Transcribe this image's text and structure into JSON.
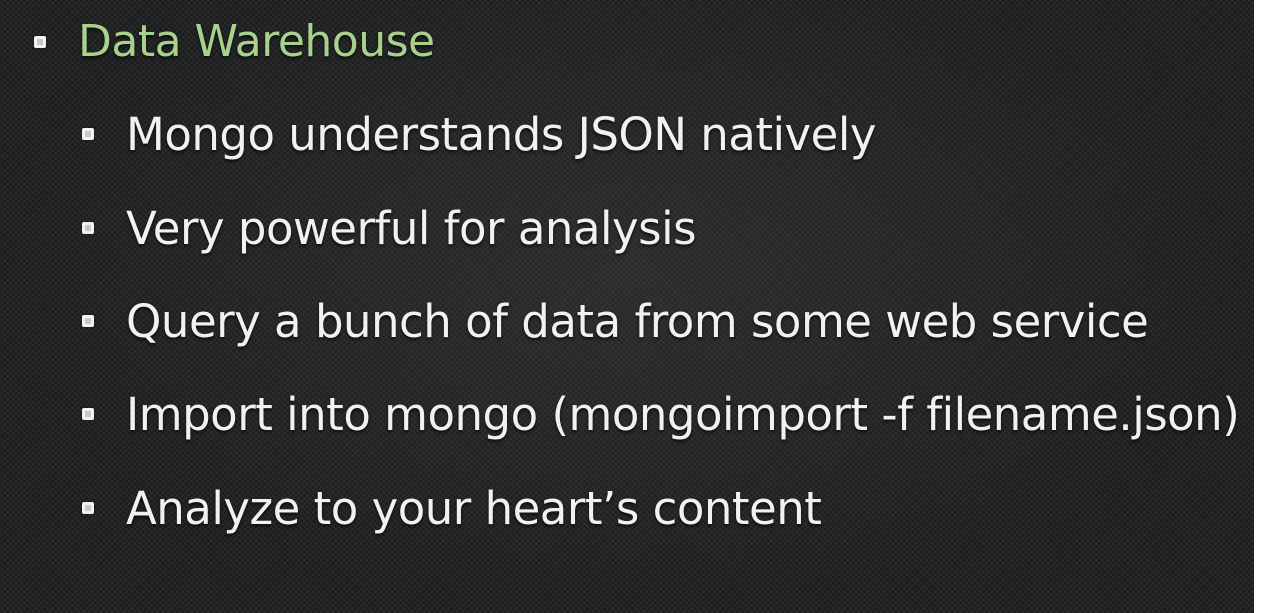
{
  "slide": {
    "heading": "Data Warehouse",
    "accent_color": "#a9d18e",
    "text_color": "#f1f1f1",
    "background_color": "#1c1d1e",
    "bullet_icon": "square-bullet-icon",
    "items": [
      "Mongo understands JSON natively",
      "Very powerful for analysis",
      "Query a bunch of data from some web service",
      "Import into mongo (mongoimport -f filename.json)",
      "Analyze to your heart’s content"
    ]
  }
}
